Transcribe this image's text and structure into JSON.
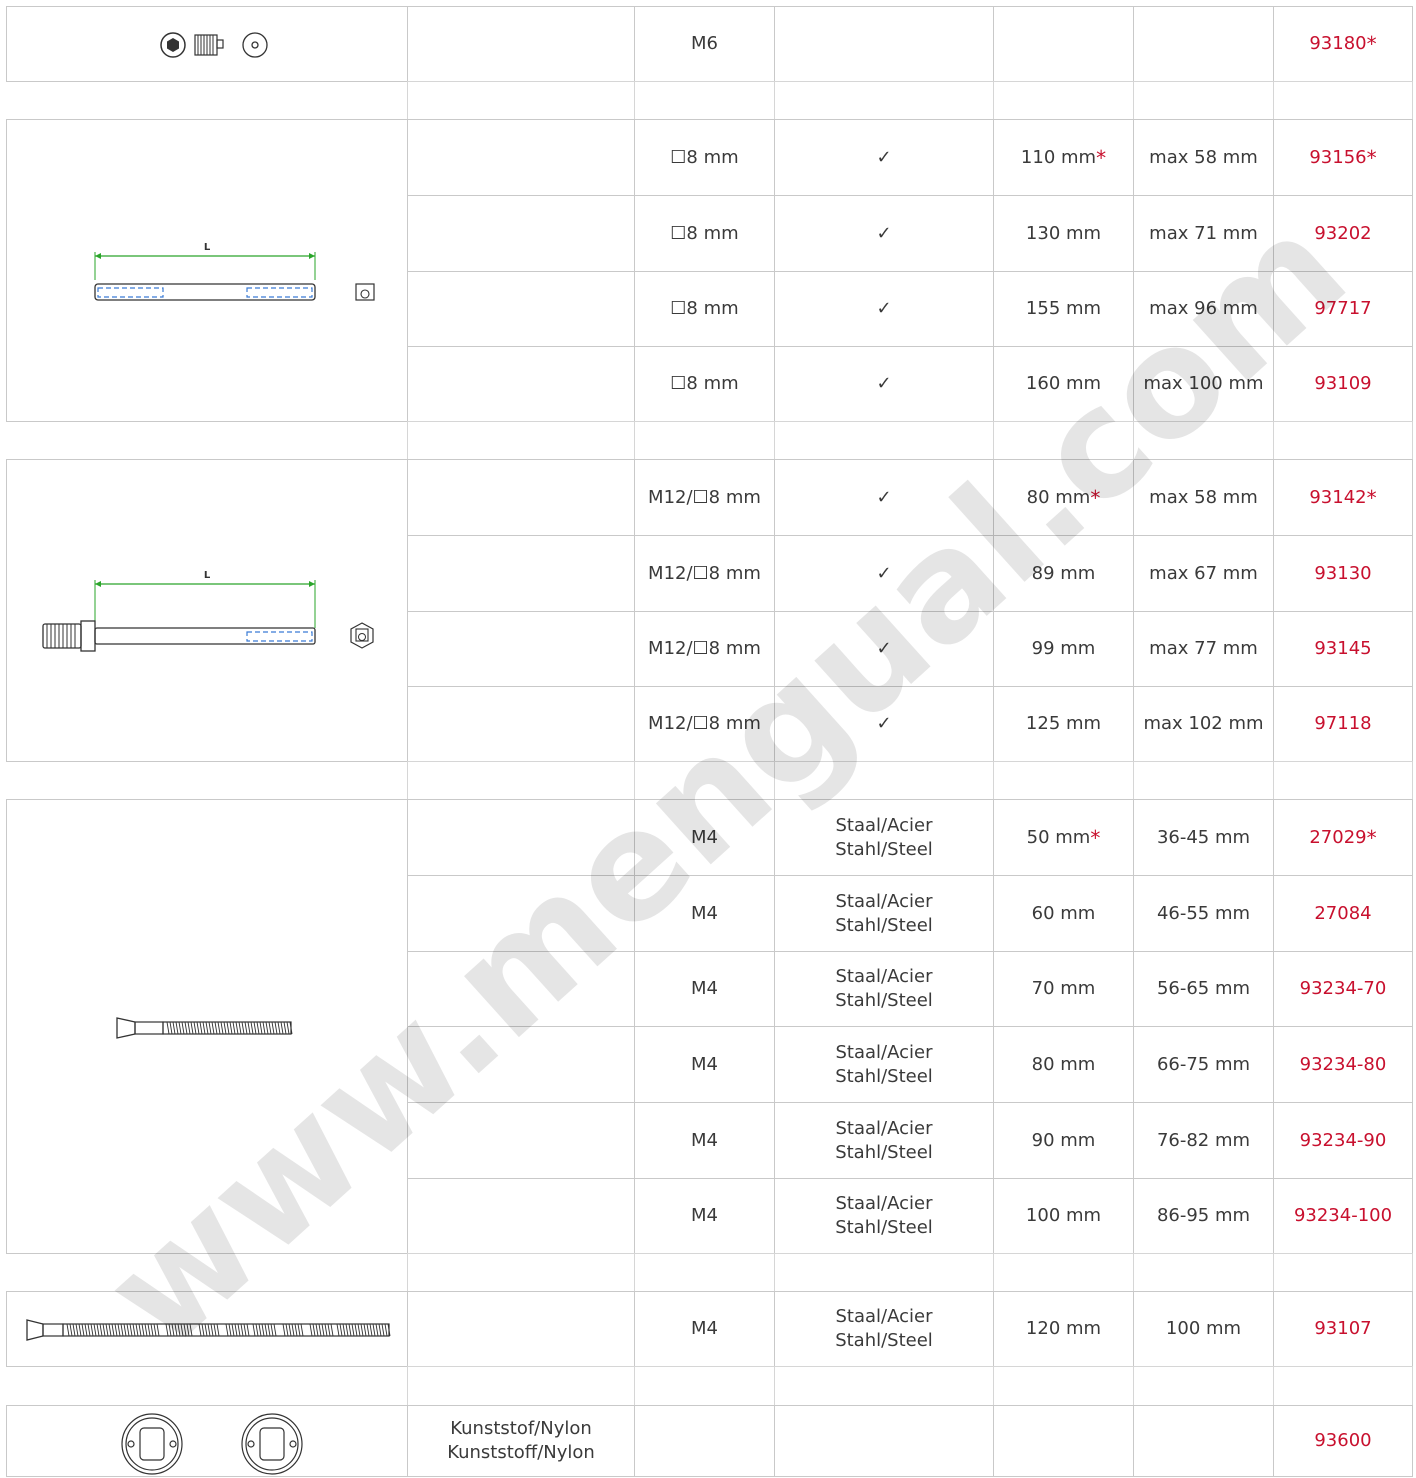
{
  "rows": [
    {
      "type": "spacer"
    },
    {
      "spec": "M6",
      "material": "",
      "length": "",
      "range": "",
      "code": "93180",
      "star_code": true,
      "star_length": false
    },
    {
      "spec": "☐8 mm",
      "material": "✓",
      "length": "110 mm",
      "range": "max 58 mm",
      "code": "93156",
      "star_code": true,
      "star_length": true
    },
    {
      "spec": "☐8 mm",
      "material": "✓",
      "length": "130 mm",
      "range": "max 71 mm",
      "code": "93202",
      "star_code": false,
      "star_length": false
    },
    {
      "spec": "☐8 mm",
      "material": "✓",
      "length": "155 mm",
      "range": "max 96 mm",
      "code": "97717",
      "star_code": false,
      "star_length": false
    },
    {
      "spec": "☐8 mm",
      "material": "✓",
      "length": "160 mm",
      "range": "max 100 mm",
      "code": "93109",
      "star_code": false,
      "star_length": false
    },
    {
      "spec": "M12/☐8 mm",
      "material": "✓",
      "length": "80 mm",
      "range": "max 58 mm",
      "code": "93142",
      "star_code": true,
      "star_length": true
    },
    {
      "spec": "M12/☐8 mm",
      "material": "✓",
      "length": "89 mm",
      "range": "max 67 mm",
      "code": "93130",
      "star_code": false,
      "star_length": false
    },
    {
      "spec": "M12/☐8 mm",
      "material": "✓",
      "length": "99 mm",
      "range": "max 77 mm",
      "code": "93145",
      "star_code": false,
      "star_length": false
    },
    {
      "spec": "M12/☐8 mm",
      "material": "✓",
      "length": "125 mm",
      "range": "max 102 mm",
      "code": "97118",
      "star_code": false,
      "star_length": false
    },
    {
      "spec": "M4",
      "material": "Staal/Acier\nStahl/Steel",
      "length": "50 mm",
      "range": "36-45 mm",
      "code": "27029",
      "star_code": true,
      "star_length": true
    },
    {
      "spec": "M4",
      "material": "Staal/Acier\nStahl/Steel",
      "length": "60 mm",
      "range": "46-55 mm",
      "code": "27084",
      "star_code": false,
      "star_length": false
    },
    {
      "spec": "M4",
      "material": "Staal/Acier\nStahl/Steel",
      "length": "70 mm",
      "range": "56-65 mm",
      "code": "93234-70",
      "star_code": false,
      "star_length": false
    },
    {
      "spec": "M4",
      "material": "Staal/Acier\nStahl/Steel",
      "length": "80 mm",
      "range": "66-75 mm",
      "code": "93234-80",
      "star_code": false,
      "star_length": false
    },
    {
      "spec": "M4",
      "material": "Staal/Acier\nStahl/Steel",
      "length": "90 mm",
      "range": "76-82 mm",
      "code": "93234-90",
      "star_code": false,
      "star_length": false
    },
    {
      "spec": "M4",
      "material": "Staal/Acier\nStahl/Steel",
      "length": "100 mm",
      "range": "86-95 mm",
      "code": "93234-100",
      "star_code": false,
      "star_length": false
    },
    {
      "spec": "M4",
      "material": "Staal/Acier\nStahl/Steel",
      "length": "120 mm",
      "range": "100 mm",
      "code": "93107",
      "star_code": false,
      "star_length": false
    },
    {
      "spec": "",
      "material": "",
      "length": "",
      "range": "",
      "code": "93600",
      "star_code": false,
      "star_length": false,
      "col2": "Kunststof/Nylon\nKunststoff/Nylon"
    }
  ],
  "drawing_labels": {
    "length_label": "L"
  },
  "watermark": "www.mengual.com",
  "colors": {
    "code": "#c8102e",
    "border": "#c9c9c9",
    "dimension": "#2aa52a",
    "hidden": "#3a7bd5"
  }
}
